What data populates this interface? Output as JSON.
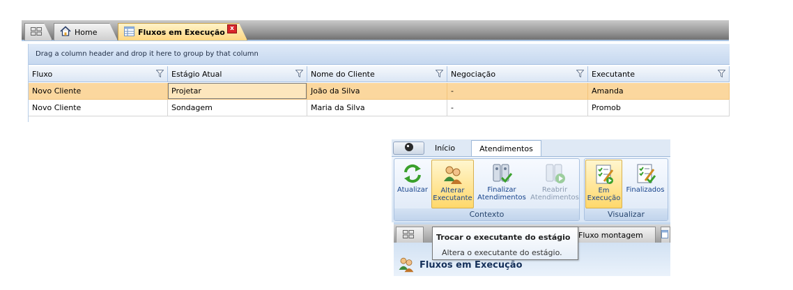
{
  "top": {
    "tabs": [
      {
        "id": "grid",
        "icon": "grid-icon"
      },
      {
        "id": "home",
        "label": "Home",
        "icon": "home-icon"
      },
      {
        "id": "fluxos",
        "label": "Fluxos em Execução",
        "icon": "table-icon",
        "close": "x",
        "active": true
      }
    ],
    "group_hint": "Drag a column header and drop it here to group by that column",
    "columns": [
      "Fluxo",
      "Estágio Atual",
      "Nome do Cliente",
      "Negociação",
      "Executante"
    ],
    "rows": [
      [
        "Novo Cliente",
        "Projetar",
        "João da Silva",
        "-",
        "Amanda"
      ],
      [
        "Novo Cliente",
        "Sondagem",
        "Maria da Silva",
        "-",
        "Promob"
      ]
    ],
    "colors": {
      "selected_row": "#fbd79e",
      "active_tab": "#ffd782",
      "header": "#dbe6f4"
    }
  },
  "ribbon": {
    "tabs": [
      "Início",
      "Atendimentos"
    ],
    "active_tab": "Atendimentos",
    "groups": [
      {
        "caption": "Contexto",
        "buttons": [
          {
            "label": "Atualizar",
            "icon": "refresh-icon"
          },
          {
            "label": "Alterar\nExecutante",
            "icon": "users-icon",
            "state": "hover"
          },
          {
            "label": "Finalizar\nAtendimentos",
            "icon": "finalize-icon"
          },
          {
            "label": "Reabrir\nAtendimentos",
            "icon": "reopen-icon",
            "state": "disabled"
          }
        ]
      },
      {
        "caption": "Visualizar",
        "buttons": [
          {
            "label": "Em\nExecução",
            "icon": "checklist-icon",
            "state": "active"
          },
          {
            "label": "Finalizados",
            "icon": "checklist-done-icon"
          }
        ]
      }
    ],
    "inner_tab_label": "Fluxo montagem",
    "inner_title": "Fluxos em Execução",
    "tooltip": {
      "title": "Trocar o executante do estágio",
      "description": "Altera o executante do estágio."
    }
  }
}
